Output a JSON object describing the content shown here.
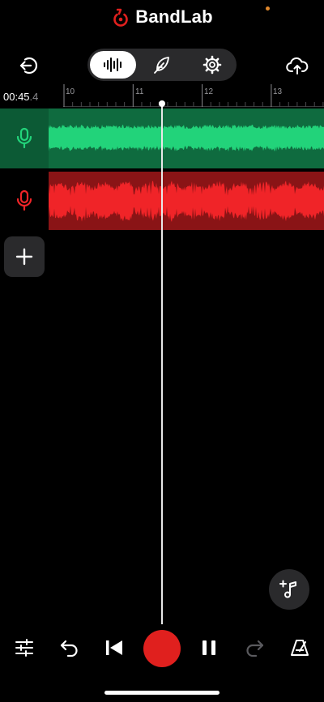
{
  "app": {
    "name": "BandLab",
    "brand_color": "#e0201e"
  },
  "header": {
    "back_icon": "exit-icon",
    "upload_icon": "cloud-upload-icon",
    "segments": [
      {
        "icon": "waveform-icon",
        "selected": true
      },
      {
        "icon": "feather-icon",
        "selected": false
      },
      {
        "icon": "gear-icon",
        "selected": false
      }
    ]
  },
  "timeline": {
    "position": "00:45",
    "position_fraction": ".4",
    "ruler_labels": [
      "10",
      "11",
      "12",
      "13"
    ]
  },
  "tracks": [
    {
      "type": "voice",
      "color": "#22d37a",
      "region_color": "#0f6b3f",
      "icon": "microphone-icon"
    },
    {
      "type": "voice",
      "color": "#f02428",
      "region_color": "#8a1416",
      "icon": "microphone-icon"
    }
  ],
  "add_track_icon": "plus-icon",
  "add_loop_icon": "add-music-note-icon",
  "transport": {
    "items": [
      "mixer-icon",
      "undo-icon",
      "skip-to-start-icon",
      "record-button",
      "pause-icon",
      "redo-icon",
      "metronome-icon"
    ]
  }
}
